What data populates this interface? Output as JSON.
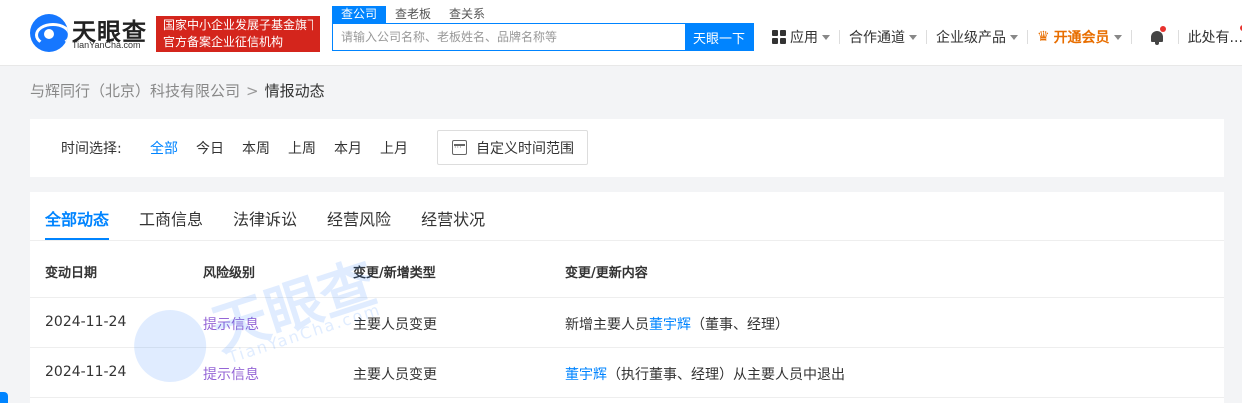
{
  "header": {
    "logo_cn": "天眼查",
    "logo_en": "TianYanCha.com",
    "slogan_line1": "国家中小企业发展子基金旗下",
    "slogan_line2": "官方备案企业征信机构",
    "search_tabs": [
      "查公司",
      "查老板",
      "查关系"
    ],
    "search_placeholder": "请输入公司名称、老板姓名、品牌名称等",
    "search_button": "天眼一下",
    "nav": {
      "apps": "应用",
      "channel": "合作通道",
      "enterprise": "企业级产品",
      "vip": "开通会员",
      "user": "此处有..."
    },
    "icons": [
      "apps-grid-icon",
      "crown-icon",
      "bell-icon"
    ]
  },
  "breadcrumb": {
    "company": "与辉同行（北京）科技有限公司",
    "separator": ">",
    "current": "情报动态"
  },
  "time_filter": {
    "label": "时间选择:",
    "options": [
      "全部",
      "今日",
      "本周",
      "上周",
      "本月",
      "上月"
    ],
    "selected": "全部",
    "custom": "自定义时间范围"
  },
  "tabs": [
    "全部动态",
    "工商信息",
    "法律诉讼",
    "经营风险",
    "经营状况"
  ],
  "table": {
    "headers": [
      "变动日期",
      "风险级别",
      "变更/新增类型",
      "变更/更新内容"
    ],
    "rows": [
      {
        "date": "2024-11-24",
        "risk": "提示信息",
        "type": "主要人员变更",
        "content_prefix": "新增主要人员",
        "content_link": "董宇辉",
        "content_suffix": "（董事、经理）"
      },
      {
        "date": "2024-11-24",
        "risk": "提示信息",
        "type": "主要人员变更",
        "content_prefix": "",
        "content_link": "董宇辉",
        "content_suffix": "（执行董事、经理）从主要人员中退出"
      }
    ]
  },
  "watermark": {
    "cn": "天眼查",
    "en": "TianYanCha.com"
  },
  "colors": {
    "accent": "#0084ff",
    "slogan_bg": "#d4251c",
    "vip": "#e86e00",
    "risk_hint": "#9566d6",
    "notification": "#e8322e"
  }
}
